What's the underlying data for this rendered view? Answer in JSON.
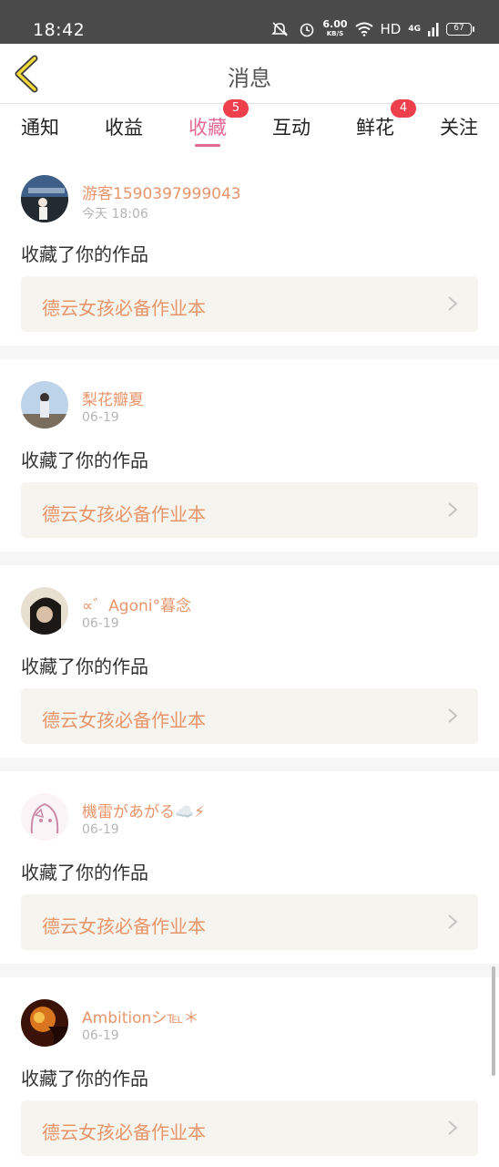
{
  "status_bar": {
    "time": "18:42",
    "speed_value": "6.00",
    "speed_unit": "KB/S",
    "hd": "HD",
    "network": "4G",
    "battery": "67"
  },
  "nav": {
    "title": "消息"
  },
  "tabs": [
    {
      "label": "通知"
    },
    {
      "label": "收益"
    },
    {
      "label": "收藏",
      "badge": "5"
    },
    {
      "label": "互动"
    },
    {
      "label": "鲜花",
      "badge": "4"
    },
    {
      "label": "关注"
    }
  ],
  "colors": {
    "accent_pink": "#e36a94",
    "name_orange": "#e8956a",
    "badge_red": "#ee3f4d"
  },
  "items": [
    {
      "user": "游客1590397999043",
      "time": "今天 18:06",
      "action": "收藏了你的作品",
      "work": "德云女孩必备作业本",
      "icon": "chevron-right-icon"
    },
    {
      "user": "梨花瓣夏",
      "time": "06-19",
      "action": "收藏了你的作品",
      "work": "德云女孩必备作业本",
      "icon": "chevron-right-icon"
    },
    {
      "user": "∝゛Agoni°暮念",
      "time": "06-19",
      "action": "收藏了你的作品",
      "work": "德云女孩必备作业本",
      "icon": "chevron-right-icon"
    },
    {
      "user": "機雷があがる☁️⚡",
      "time": "06-19",
      "action": "收藏了你的作品",
      "work": "德云女孩必备作业本",
      "icon": "chevron-right-icon"
    },
    {
      "user": "Ambitionシ℡＊",
      "time": "06-19",
      "action": "收藏了你的作品",
      "work": "德云女孩必备作业本",
      "icon": "chevron-right-icon"
    }
  ]
}
